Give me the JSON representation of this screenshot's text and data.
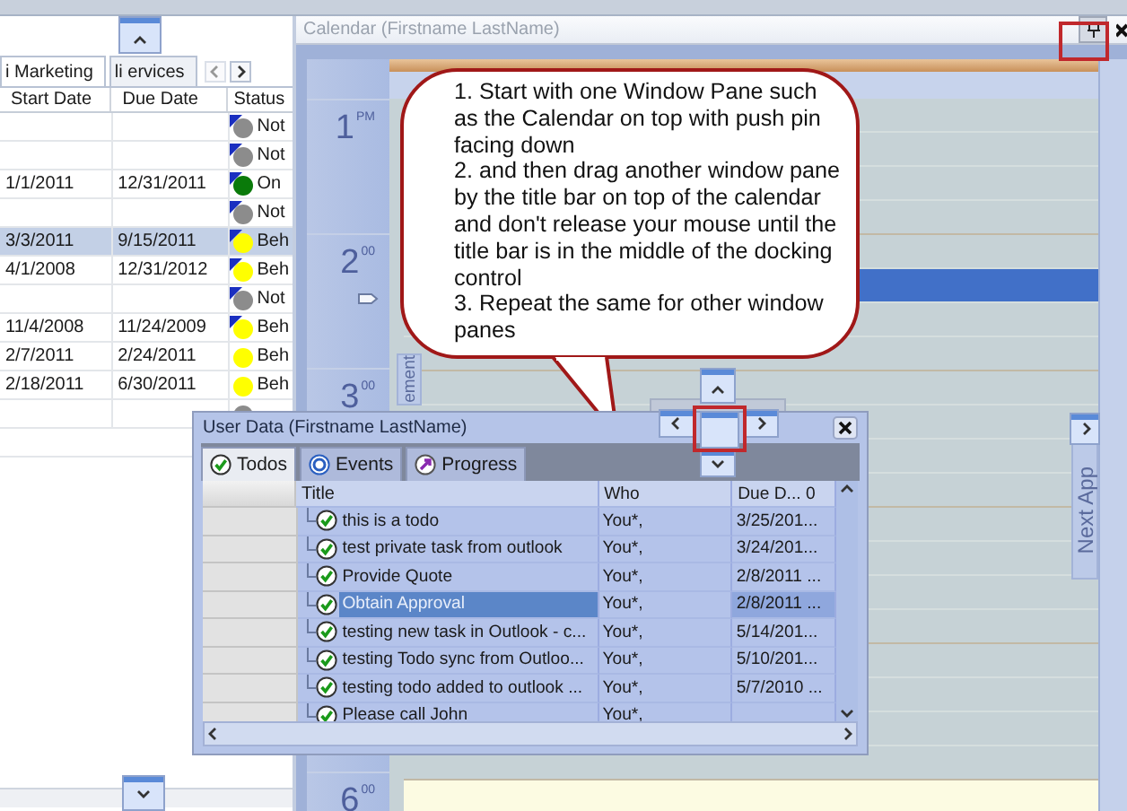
{
  "grid_panel": {
    "tabs": [
      {
        "label": "i Marketing",
        "selected": true
      },
      {
        "label": "li ervices",
        "selected": false
      }
    ],
    "columns": [
      "Start Date",
      "Due Date",
      "Status"
    ],
    "rows": [
      {
        "start": "",
        "due": "",
        "status": "Not",
        "color": "#8c8c8c",
        "flagged": true,
        "selected": false
      },
      {
        "start": "",
        "due": "",
        "status": "Not",
        "color": "#8c8c8c",
        "flagged": true,
        "selected": false
      },
      {
        "start": "1/1/2011",
        "due": "12/31/2011",
        "status": "On",
        "color": "#0a7a0a",
        "flagged": true,
        "selected": false
      },
      {
        "start": "",
        "due": "",
        "status": "Not",
        "color": "#8c8c8c",
        "flagged": true,
        "selected": false
      },
      {
        "start": "3/3/2011",
        "due": "9/15/2011",
        "status": "Beh",
        "color": "#ffff00",
        "flagged": true,
        "selected": true
      },
      {
        "start": "4/1/2008",
        "due": "12/31/2012",
        "status": "Beh",
        "color": "#ffff00",
        "flagged": true,
        "selected": false
      },
      {
        "start": "",
        "due": "",
        "status": "Not",
        "color": "#8c8c8c",
        "flagged": true,
        "selected": false
      },
      {
        "start": "11/4/2008",
        "due": "11/24/2009",
        "status": "Beh",
        "color": "#ffff00",
        "flagged": true,
        "selected": false
      },
      {
        "start": "2/7/2011",
        "due": "2/24/2011",
        "status": "Beh",
        "color": "#ffff00",
        "flagged": false,
        "selected": false
      },
      {
        "start": "2/18/2011",
        "due": "6/30/2011",
        "status": "Beh",
        "color": "#ffff00",
        "flagged": false,
        "selected": false
      },
      {
        "start": "",
        "due": "",
        "color": "#8c8c8c",
        "flagged": false,
        "selected": false
      }
    ]
  },
  "calendar": {
    "title": "Calendar (Firstname LastName)",
    "times": [
      {
        "hour": "1",
        "suffix": "PM"
      },
      {
        "hour": "2",
        "suffix": "00"
      },
      {
        "hour": "3",
        "suffix": "00"
      },
      {
        "hour": "6",
        "suffix": "00"
      }
    ],
    "left_tab": "ement",
    "right_tab": "Next App"
  },
  "callout": {
    "steps": [
      "1. Start with one Window Pane such as the Calendar on top with push pin facing down",
      "2. and then drag another window pane by the title bar on top of the calendar and don't release your mouse until the  title bar is in the middle of the docking control",
      "3. Repeat the same for other window panes"
    ]
  },
  "user_data": {
    "title": "User Data (Firstname LastName)",
    "tabs": [
      {
        "label": "Todos",
        "kind": "todo",
        "selected": true
      },
      {
        "label": "Events",
        "kind": "event",
        "selected": false
      },
      {
        "label": "Progress",
        "kind": "progress",
        "selected": false
      }
    ],
    "columns": [
      "Title",
      "Who",
      "Due D... 0"
    ],
    "rows": [
      {
        "title": "this is a todo",
        "who": "You*,",
        "due": "3/25/201...",
        "selected": false
      },
      {
        "title": "test private task from outlook",
        "who": "You*,",
        "due": "3/24/201...",
        "selected": false
      },
      {
        "title": "Provide Quote",
        "who": "You*,",
        "due": "2/8/2011 ...",
        "selected": false
      },
      {
        "title": "Obtain Approval",
        "who": "You*,",
        "due": "2/8/2011 ...",
        "selected": true
      },
      {
        "title": "testing new task in Outlook - c...",
        "who": "You*,",
        "due": "5/14/201...",
        "selected": false
      },
      {
        "title": "testing Todo sync from Outloo...",
        "who": "You*,",
        "due": "5/10/201...",
        "selected": false
      },
      {
        "title": "testing todo added to outlook ...",
        "who": "You*,",
        "due": "5/7/2010 ...",
        "selected": false
      },
      {
        "title": "Please call John",
        "who": "You*,",
        "due": "",
        "selected": false
      }
    ]
  }
}
